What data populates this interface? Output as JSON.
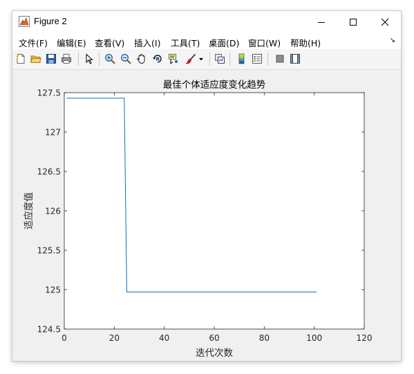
{
  "window": {
    "title": "Figure 2",
    "icon": "matlab-figure-icon",
    "controls": [
      "minimize",
      "maximize",
      "close"
    ]
  },
  "menu": {
    "items": [
      "文件(F)",
      "编辑(E)",
      "查看(V)",
      "插入(I)",
      "工具(T)",
      "桌面(D)",
      "窗口(W)",
      "帮助(H)"
    ],
    "overflow_icon": "dock-arrow-icon"
  },
  "toolbar": {
    "icons": [
      "new-figure-icon",
      "open-file-icon",
      "save-icon",
      "print-icon",
      "edit-plot-icon",
      "zoom-in-icon",
      "zoom-out-icon",
      "pan-icon",
      "rotate-3d-icon",
      "data-cursor-icon",
      "brush-icon",
      "brush-dropdown-icon",
      "link-plot-icon",
      "insert-colorbar-icon",
      "insert-legend-icon",
      "hide-plot-tools-icon",
      "show-plot-tools-icon"
    ]
  },
  "colors": {
    "series": "#0072bd",
    "axes": "#262626",
    "figure_bg": "#f0f0f0"
  },
  "chart_data": {
    "type": "line",
    "title": "最佳个体适应度变化趋势",
    "xlabel": "迭代次数",
    "ylabel": "适应度值",
    "xlim": [
      0,
      120
    ],
    "ylim": [
      124.5,
      127.5
    ],
    "xticks": [
      0,
      20,
      40,
      60,
      80,
      100,
      120
    ],
    "yticks": [
      124.5,
      125,
      125.5,
      126,
      126.5,
      127,
      127.5
    ],
    "ytick_labels": [
      "124.5",
      "125",
      "125.5",
      "126",
      "126.5",
      "127",
      "127.5"
    ],
    "grid": false,
    "series": [
      {
        "x": [
          1,
          24,
          25,
          101
        ],
        "y": [
          127.43,
          127.43,
          124.97,
          124.97
        ],
        "color": "#0072bd"
      }
    ]
  }
}
